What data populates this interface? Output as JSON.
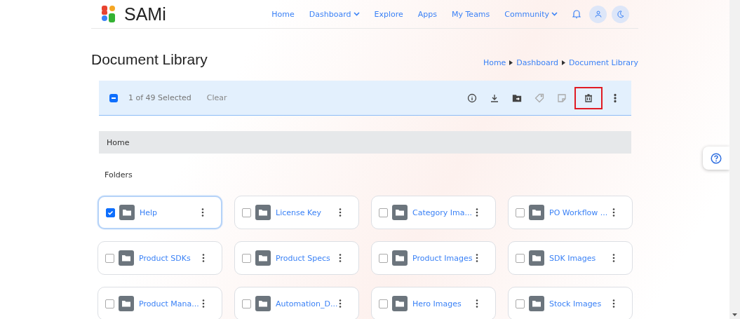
{
  "brand": "SAMi",
  "nav": [
    {
      "label": "Home",
      "dropdown": false
    },
    {
      "label": "Dashboard",
      "dropdown": true
    },
    {
      "label": "Explore",
      "dropdown": false
    },
    {
      "label": "Apps",
      "dropdown": false
    },
    {
      "label": "My Teams",
      "dropdown": false
    },
    {
      "label": "Community",
      "dropdown": true
    }
  ],
  "title": "Document Library",
  "breadcrumb": [
    "Home",
    "Dashboard",
    "Document Library"
  ],
  "selection": {
    "checked": true,
    "indeterminate": true,
    "count": "1 of 49 Selected",
    "clear": "Clear"
  },
  "actions": [
    {
      "kind": "info",
      "disabled": false,
      "highlighted": false
    },
    {
      "kind": "download",
      "disabled": false,
      "highlighted": false
    },
    {
      "kind": "move",
      "disabled": false,
      "highlighted": false
    },
    {
      "kind": "tag",
      "disabled": true,
      "highlighted": false
    },
    {
      "kind": "note",
      "disabled": true,
      "highlighted": false
    },
    {
      "kind": "delete",
      "disabled": false,
      "highlighted": true
    },
    {
      "kind": "more",
      "disabled": false,
      "highlighted": false
    }
  ],
  "path": "Home",
  "section": "Folders",
  "folders": [
    {
      "name": "Help",
      "checked": true
    },
    {
      "name": "License Key",
      "checked": false
    },
    {
      "name": "Category Ima...",
      "checked": false
    },
    {
      "name": "PO Workflow ...",
      "checked": false
    },
    {
      "name": "Product SDKs",
      "checked": false
    },
    {
      "name": "Product Specs",
      "checked": false
    },
    {
      "name": "Product Images",
      "checked": false
    },
    {
      "name": "SDK Images",
      "checked": false
    },
    {
      "name": "Product Mana...",
      "checked": false
    },
    {
      "name": "Automation_D...",
      "checked": false
    },
    {
      "name": "Hero Images",
      "checked": false
    },
    {
      "name": "Stock Images",
      "checked": false
    }
  ]
}
